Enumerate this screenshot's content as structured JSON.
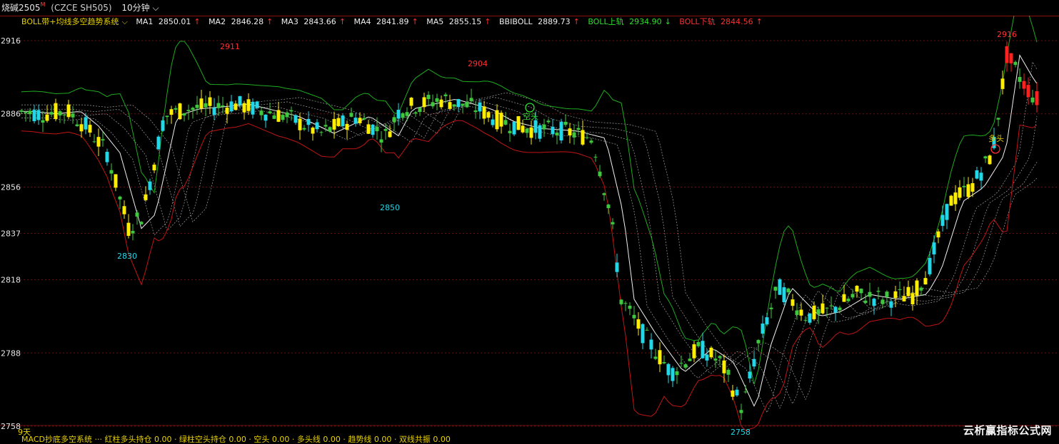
{
  "title_bar": {
    "symbol_name": "烧碱2505",
    "superscript": "M",
    "code": "(CZCE SH505)",
    "period": "10分钟",
    "period_arrow": "⌵"
  },
  "legend": {
    "system_name": "BOLL带+均线多空趋势系统",
    "dropdown_arrow": "⌵",
    "items": [
      {
        "label": "MA1",
        "value": "2850.01",
        "arrow": "↑",
        "color": "white"
      },
      {
        "label": "MA2",
        "value": "2846.28",
        "arrow": "↑",
        "color": "white"
      },
      {
        "label": "MA3",
        "value": "2843.66",
        "arrow": "↑",
        "color": "white"
      },
      {
        "label": "MA4",
        "value": "2841.89",
        "arrow": "↑",
        "color": "white"
      },
      {
        "label": "MA5",
        "value": "2855.15",
        "arrow": "↑",
        "color": "white"
      },
      {
        "label": "BBIBOLL",
        "value": "2889.73",
        "arrow": "↑",
        "color": "white"
      },
      {
        "label": "BOLL上轨",
        "value": "2934.90",
        "arrow": "↓",
        "color": "green"
      },
      {
        "label": "BOLL下轨",
        "value": "2844.56",
        "arrow": "↑",
        "color": "red"
      }
    ]
  },
  "y_axis": {
    "ticks": [
      2916,
      2886,
      2856,
      2837,
      2818,
      2788,
      2758
    ]
  },
  "annotations": {
    "high_1": "2911",
    "high_2": "2904",
    "high_3": "2916",
    "low_1": "2830",
    "low_2": "2850",
    "low_3": "2758",
    "signal_short": "空头",
    "signal_long": "多头"
  },
  "days_label": "9天",
  "bottom_legend": "MACD抄底多空系统 ··· 红柱多头持仓 0.00 · 绿柱空头持仓 0.00 · 空头 0.00 · 多头线 0.00 · 趋势线 0.00 · 双线共振 0.00",
  "watermark": "云析赢指标公式网",
  "colors": {
    "background": "#000000",
    "bull_candle": "#ffee00",
    "bear_candle": "#22d8e8",
    "small_candle": "#3ec83e",
    "upper_band": "#1faa1f",
    "lower_band": "#c01515",
    "mid_line": "#f0f0f0",
    "grid": "#6a1010",
    "label_high": "#ff3030",
    "label_low": "#22d8e8"
  }
}
